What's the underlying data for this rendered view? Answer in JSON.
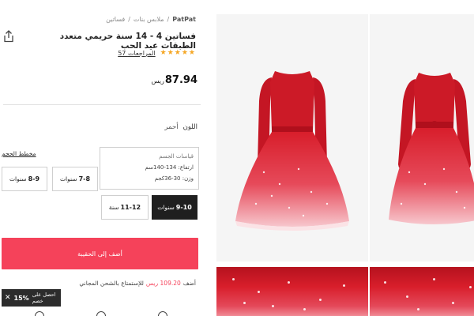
{
  "breadcrumb": {
    "brand": "PatPat",
    "sep": "/",
    "category": "ملابس بنات",
    "subcategory": "فساتين"
  },
  "product": {
    "title": "فساتين 4 - 14 سنة حريمي متعدد الطبقات عيد الحب",
    "rating_stars": "★★★★★",
    "reviews_label": "57 المراجعات",
    "price": "87.94",
    "currency": "ريس"
  },
  "color": {
    "label": "اللون",
    "value": "أحمر"
  },
  "size": {
    "chart_link": "مخطط الحجم",
    "tooltip": {
      "title": "قياسات الجسم",
      "height": "ارتفاع: 134-140سم",
      "weight": "وزن: 30-36كجم"
    },
    "options": [
      {
        "value": "7-8",
        "unit": "سنوات"
      },
      {
        "value": "8-9",
        "unit": "سنوات"
      },
      {
        "value": "9-10",
        "unit": "سنوات"
      },
      {
        "value": "11-12",
        "unit": "سنة"
      }
    ],
    "selected": "9-10"
  },
  "cart": {
    "add_label": "أضف إلى الحقيبة"
  },
  "shipping": {
    "prefix": "أضف",
    "amount": "109.20 ريس",
    "suffix": "للإستمتاع بالشحن المجاني"
  },
  "promo": {
    "close": "✕",
    "percent": "15%",
    "text": "احصل على خصم"
  },
  "gallery": {
    "alt_main": "red velvet sequin tulle dress",
    "alt_detail": "tulle fabric detail"
  },
  "colors": {
    "accent": "#f5425a",
    "selected_bg": "#1f1f1f",
    "star": "#f5a623",
    "dress_red": "#d81e2b"
  }
}
